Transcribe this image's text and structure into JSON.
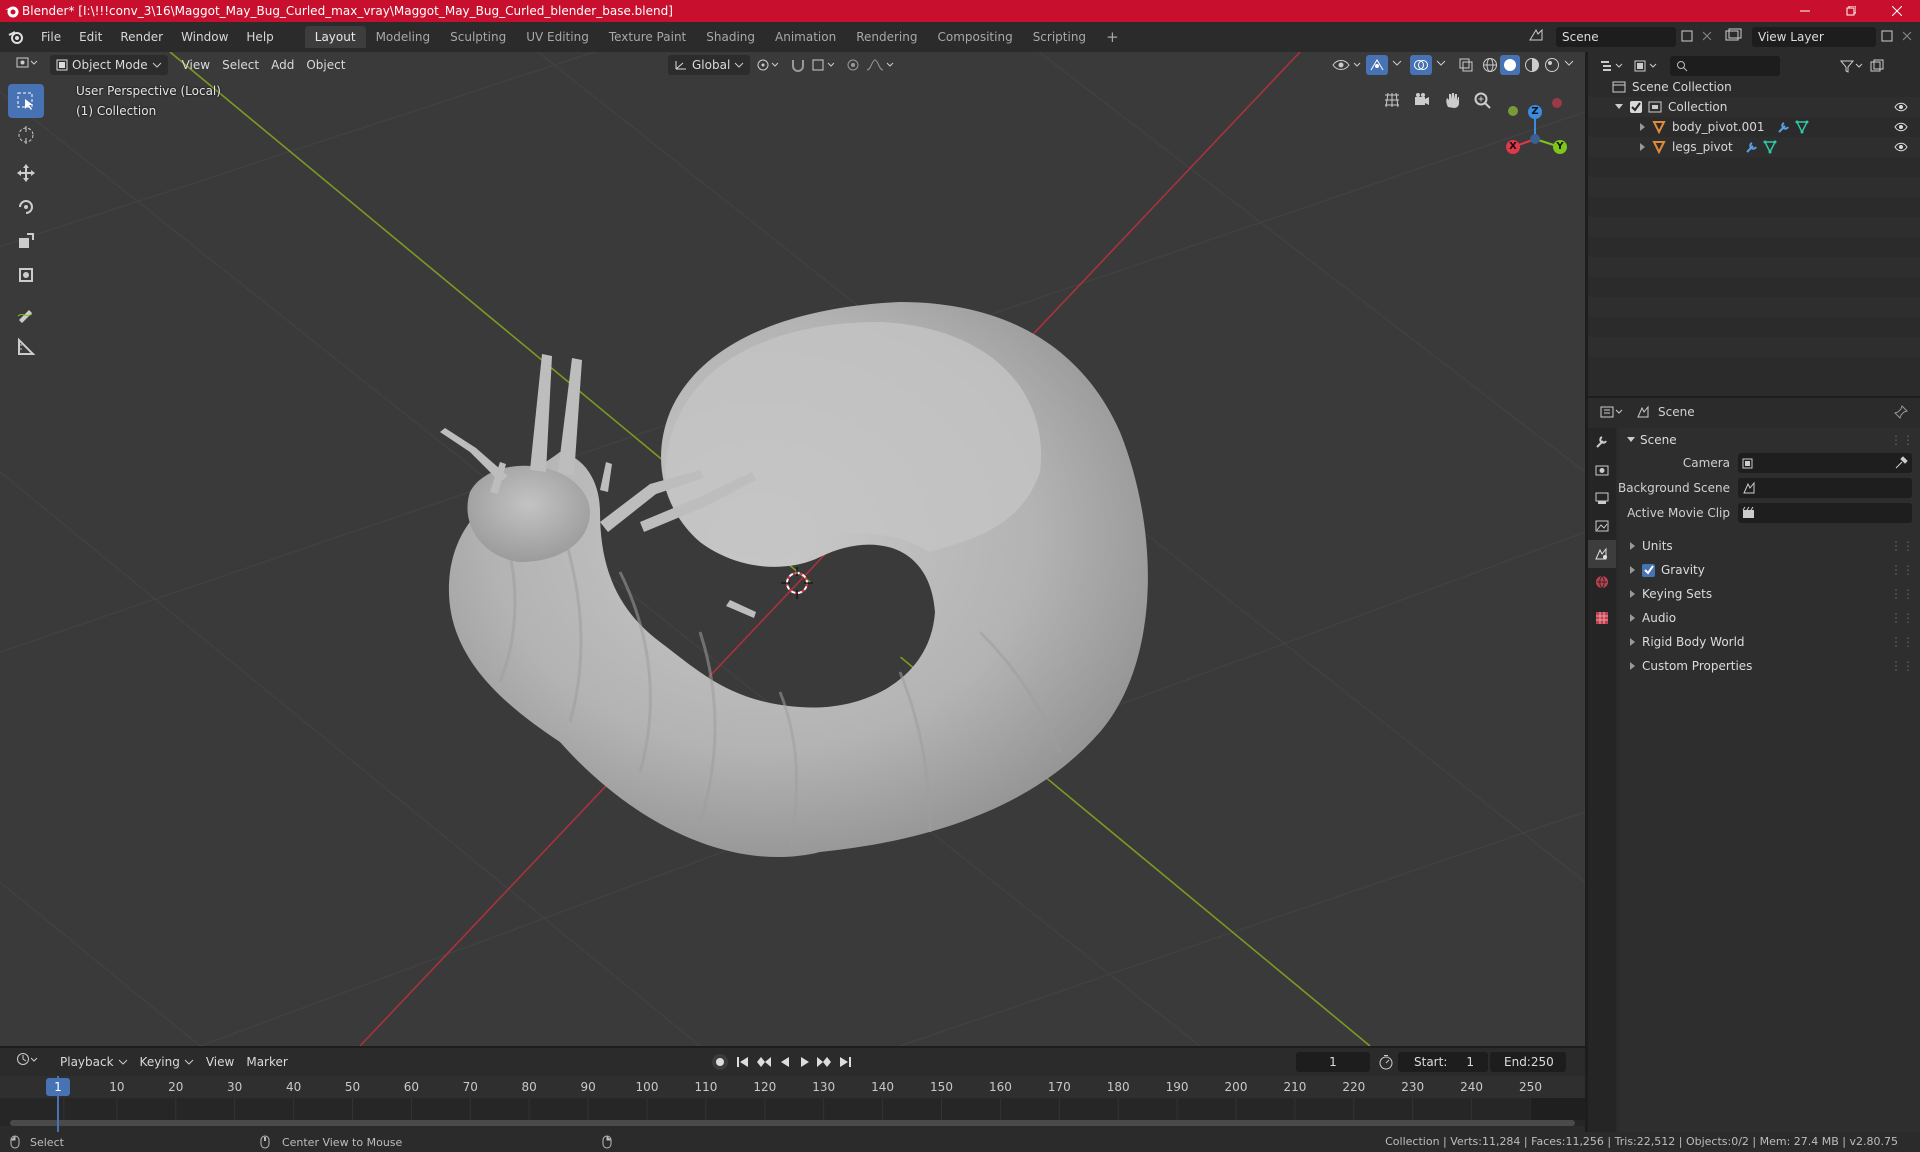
{
  "title": "Blender* [I:\\!!!conv_3\\16\\Maggot_May_Bug_Curled_max_vray\\Maggot_May_Bug_Curled_blender_base.blend]",
  "menu": [
    "File",
    "Edit",
    "Render",
    "Window",
    "Help"
  ],
  "workspaces": [
    "Layout",
    "Modeling",
    "Sculpting",
    "UV Editing",
    "Texture Paint",
    "Shading",
    "Animation",
    "Rendering",
    "Compositing",
    "Scripting"
  ],
  "active_workspace": "Layout",
  "scene_field": "Scene",
  "view_layer_field": "View Layer",
  "viewport": {
    "mode": "Object Mode",
    "menus": [
      "View",
      "Select",
      "Add",
      "Object"
    ],
    "transform_orientation": "Global",
    "perspective_label": "User Perspective (Local)",
    "collection_label": "(1) Collection",
    "gizmo": {
      "x": "X",
      "y": "Y",
      "z": "Z"
    }
  },
  "outliner": {
    "search_placeholder": "",
    "scene_collection": "Scene Collection",
    "collection": "Collection",
    "objects": [
      "body_pivot.001",
      "legs_pivot"
    ]
  },
  "properties": {
    "header": "Scene",
    "panel_title": "Scene",
    "camera_label": "Camera",
    "background_scene_label": "Background Scene",
    "active_movie_clip_label": "Active Movie Clip",
    "sections": [
      "Units",
      "Gravity",
      "Keying Sets",
      "Audio",
      "Rigid Body World",
      "Custom Properties"
    ],
    "gravity_checked": true
  },
  "timeline": {
    "menus": [
      "Playback",
      "Keying",
      "View",
      "Marker"
    ],
    "current_frame": "1",
    "start_label": "Start:",
    "start": "1",
    "end_label": "End:",
    "end": "250",
    "ruler": [
      "1",
      "10",
      "20",
      "30",
      "40",
      "50",
      "60",
      "70",
      "80",
      "90",
      "100",
      "110",
      "120",
      "130",
      "140",
      "150",
      "160",
      "170",
      "180",
      "190",
      "200",
      "210",
      "220",
      "230",
      "240",
      "250"
    ]
  },
  "status": {
    "left_action": "Select",
    "middle_action": "Center View to Mouse",
    "stats": "Collection | Verts:11,284 | Faces:11,256 | Tris:22,512 | Objects:0/2 | Mem: 27.4 MB | v2.80.75"
  },
  "colors": {
    "title_bar": "#c8102e",
    "accent": "#4772b3",
    "x_axis": "#e0384b",
    "y_axis": "#7ec61b",
    "z_axis": "#3d8be0"
  }
}
